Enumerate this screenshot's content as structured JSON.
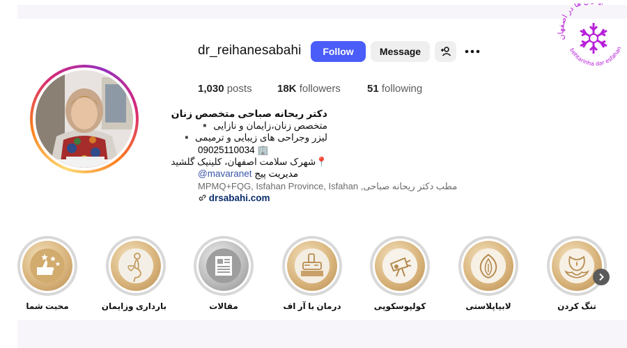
{
  "profile": {
    "username": "dr_reihanesabahi",
    "follow_label": "Follow",
    "message_label": "Message"
  },
  "stats": {
    "posts_count": "1,030",
    "posts_label": "posts",
    "followers_count": "18K",
    "followers_label": "followers",
    "following_count": "51",
    "following_label": "following"
  },
  "bio": {
    "name": "دکتر ریحانه صباحی متخصص زنان",
    "line1": "متخصص زنان،زایمان و نازایی ▪️",
    "line2": "لیزر وجراحی های زیبایی و ترمیمی ▪️",
    "phone": "09025110034",
    "phone_icon": "🏢",
    "address": "شهرک سلامت اصفهان، کلینیک گلشید",
    "address_icon": "📍",
    "manage_prefix": "مدیریت پیج",
    "manage_handle": "@mavaranet",
    "location_suffix": "مطب دکتر ریحانه صباحی,",
    "location": "MPMQ+FQG, Isfahan Province, Isfahan",
    "website": "drsabahi.com"
  },
  "highlights": [
    {
      "label": "محبت شما",
      "icon": "hand-stars-icon"
    },
    {
      "label": "بارداری وزایمان",
      "icon": "pregnancy-icon"
    },
    {
      "label": "مقالات",
      "icon": "articles-icon"
    },
    {
      "label": "درمان با آر اف",
      "icon": "rf-device-icon"
    },
    {
      "label": "کولپوسکوپی",
      "icon": "colposcope-icon"
    },
    {
      "label": "لابیاپلاستی",
      "icon": "labiaplasty-icon"
    },
    {
      "label": "تنگ کردن",
      "icon": "tightening-icon"
    }
  ],
  "colors": {
    "follow_button": "#4a5df9",
    "secondary_button": "#efefef",
    "highlight_gold": "#d9b57d",
    "logo_purple": "#b620d8"
  },
  "logo": {
    "text_top": "بهترین ها در اصفهان",
    "text_bottom": "behtarinha dar esfahan"
  }
}
